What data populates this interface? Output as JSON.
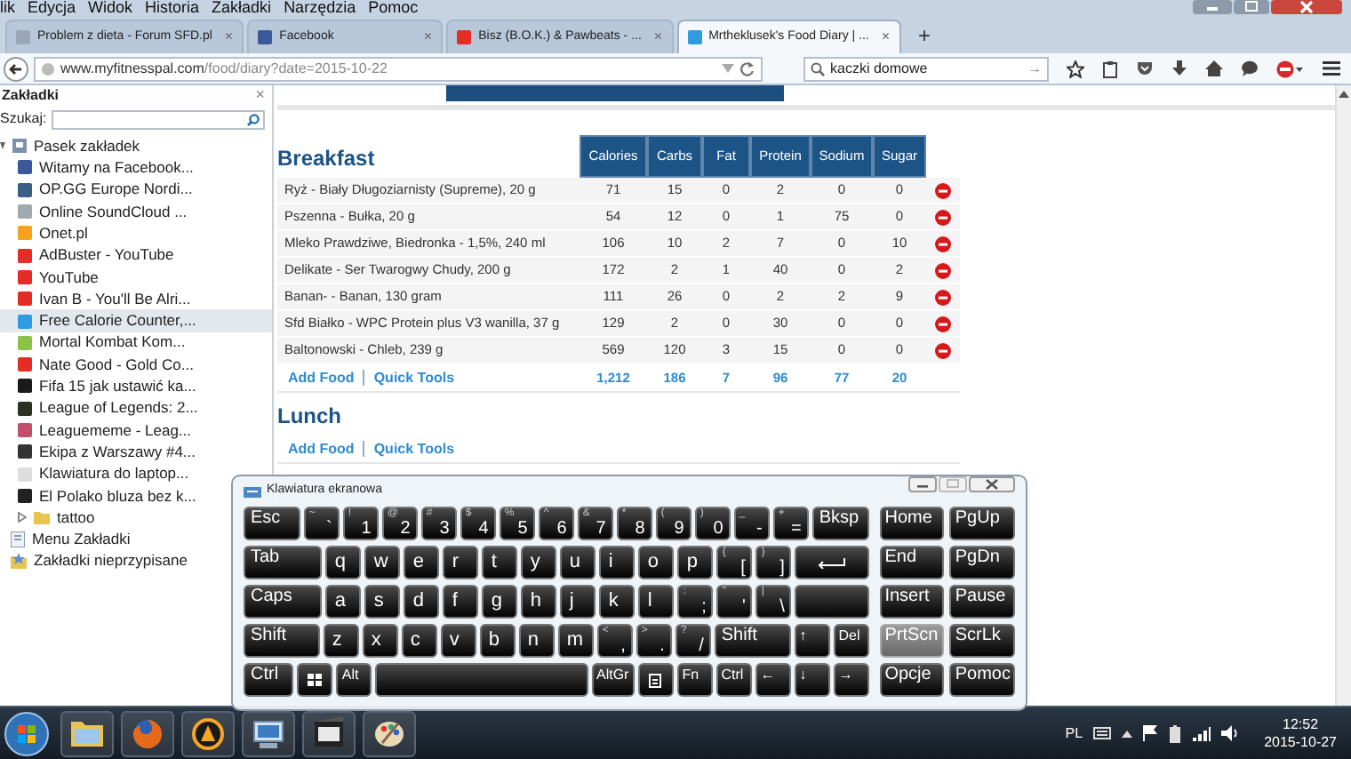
{
  "menu": [
    "lik",
    "Edycja",
    "Widok",
    "Historia",
    "Zakładki",
    "Narzędzia",
    "Pomoc"
  ],
  "tabs": [
    {
      "title": "Problem z dieta - Forum SFD.pl",
      "close": "×",
      "selected": false,
      "color": "#9aa7b8"
    },
    {
      "title": "Facebook",
      "close": "×",
      "selected": false,
      "color": "#3b5998"
    },
    {
      "title": "Bisz (B.O.K.) & Pawbeats - ...",
      "close": "×",
      "selected": false,
      "color": "#e52d27"
    },
    {
      "title": "Mrtheklusek's Food Diary | ...",
      "close": "×",
      "selected": true,
      "color": "#2f9be0"
    }
  ],
  "new_tab": "+",
  "address": {
    "host": "www.myfitnesspal.com",
    "path": "/food/diary?date=2015-10-22"
  },
  "search": {
    "value": "kaczki domowe",
    "go": "→"
  },
  "sidebar": {
    "title": "Zakładki",
    "close": "×",
    "search_label": "Szukaj:",
    "tree": [
      {
        "label": "Pasek zakładek",
        "kind": "toolbar",
        "selected": false,
        "expanded": true,
        "children": [
          {
            "label": "Witamy na Facebook...",
            "kind": "bookmark",
            "selected": false,
            "color": "#3b5998"
          },
          {
            "label": "OP.GG Europe Nordi...",
            "kind": "bookmark",
            "selected": false,
            "color": "#3a5f86"
          },
          {
            "label": "Online SoundCloud ...",
            "kind": "bookmark",
            "selected": false,
            "color": "#a0a8b0"
          },
          {
            "label": "Onet.pl",
            "kind": "bookmark",
            "selected": false,
            "color": "#f7a21b"
          },
          {
            "label": "AdBuster - YouTube",
            "kind": "bookmark",
            "selected": false,
            "color": "#e52d27"
          },
          {
            "label": "YouTube",
            "kind": "bookmark",
            "selected": false,
            "color": "#e52d27"
          },
          {
            "label": "Ivan B - You'll Be Alri...",
            "kind": "bookmark",
            "selected": false,
            "color": "#e52d27"
          },
          {
            "label": "Free Calorie Counter,...",
            "kind": "bookmark",
            "selected": true,
            "color": "#2f9be0"
          },
          {
            "label": "Mortal Kombat Kom...",
            "kind": "bookmark",
            "selected": false,
            "color": "#8bc34a"
          },
          {
            "label": "Nate Good - Gold Co...",
            "kind": "bookmark",
            "selected": false,
            "color": "#e52d27"
          },
          {
            "label": "Fifa 15 jak ustawić ka...",
            "kind": "bookmark",
            "selected": false,
            "color": "#1a1a1a"
          },
          {
            "label": "League of Legends: 2...",
            "kind": "bookmark",
            "selected": false,
            "color": "#2a3320"
          },
          {
            "label": "Leaguememe - Leag...",
            "kind": "bookmark",
            "selected": false,
            "color": "#c2506a"
          },
          {
            "label": "Ekipa z Warszawy #4...",
            "kind": "bookmark",
            "selected": false,
            "color": "#333333"
          },
          {
            "label": "Klawiatura do laptop...",
            "kind": "bookmark",
            "selected": false,
            "color": "#dddddd"
          },
          {
            "label": "El Polako bluza bez k...",
            "kind": "bookmark",
            "selected": false,
            "color": "#222222"
          },
          {
            "label": "tattoo",
            "kind": "folder",
            "selected": false,
            "expanded": false
          }
        ]
      },
      {
        "label": "Menu Zakładki",
        "kind": "menu",
        "selected": false
      },
      {
        "label": "Zakładki nieprzypisane",
        "kind": "unsorted",
        "selected": false
      }
    ]
  },
  "diary": [
    {
      "title": "Breakfast",
      "columns": [
        "Calories",
        "Carbs",
        "Fat",
        "Protein",
        "Sodium",
        "Sugar"
      ],
      "rows": [
        {
          "food": "Ryż - Biały Długoziarnisty (Supreme), 20 g",
          "values": [
            "71",
            "15",
            "0",
            "2",
            "0",
            "0"
          ]
        },
        {
          "food": "Pszenna - Bułka, 20 g",
          "values": [
            "54",
            "12",
            "0",
            "1",
            "75",
            "0"
          ]
        },
        {
          "food": "Mleko Prawdziwe, Biedronka - 1,5%, 240 ml",
          "values": [
            "106",
            "10",
            "2",
            "7",
            "0",
            "10"
          ]
        },
        {
          "food": "Delikate - Ser Twarogwy Chudy, 200 g",
          "values": [
            "172",
            "2",
            "1",
            "40",
            "0",
            "2"
          ]
        },
        {
          "food": "Banan- - Banan, 130 gram",
          "values": [
            "111",
            "26",
            "0",
            "2",
            "2",
            "9"
          ]
        },
        {
          "food": "Sfd Białko - WPC Protein plus V3 wanilla, 37 g",
          "values": [
            "129",
            "2",
            "0",
            "30",
            "0",
            "0"
          ]
        },
        {
          "food": "Baltonowski - Chleb, 239 g",
          "values": [
            "569",
            "120",
            "3",
            "15",
            "0",
            "0"
          ]
        }
      ],
      "totals": [
        "1,212",
        "186",
        "7",
        "96",
        "77",
        "20"
      ],
      "actions": [
        "Add Food",
        "Quick Tools"
      ]
    },
    {
      "title": "Lunch",
      "actions": [
        "Add Food",
        "Quick Tools"
      ]
    }
  ],
  "keyboard": {
    "title": "Klawiatura ekranowa",
    "rows": [
      {
        "keys": [
          {
            "kind": "label",
            "label": "Esc"
          },
          {
            "kind": "char",
            "shift": "~",
            "label": "`"
          },
          {
            "kind": "char",
            "shift": "!",
            "label": "1"
          },
          {
            "kind": "char",
            "shift": "@",
            "label": "2"
          },
          {
            "kind": "char",
            "shift": "#",
            "label": "3"
          },
          {
            "kind": "char",
            "shift": "$",
            "label": "4"
          },
          {
            "kind": "char",
            "shift": "%",
            "label": "5"
          },
          {
            "kind": "char",
            "shift": "^",
            "label": "6"
          },
          {
            "kind": "char",
            "shift": "&",
            "label": "7"
          },
          {
            "kind": "char",
            "shift": "*",
            "label": "8"
          },
          {
            "kind": "char",
            "shift": "(",
            "label": "9"
          },
          {
            "kind": "char",
            "shift": ")",
            "label": "0"
          },
          {
            "kind": "char",
            "shift": "_",
            "label": "-"
          },
          {
            "kind": "char",
            "shift": "+",
            "label": "="
          },
          {
            "kind": "label",
            "label": "Bksp"
          }
        ]
      },
      {
        "keys": [
          {
            "kind": "label",
            "label": "Tab"
          },
          {
            "kind": "letter",
            "label": "q"
          },
          {
            "kind": "letter",
            "label": "w"
          },
          {
            "kind": "letter",
            "label": "e"
          },
          {
            "kind": "letter",
            "label": "r"
          },
          {
            "kind": "letter",
            "label": "t"
          },
          {
            "kind": "letter",
            "label": "y"
          },
          {
            "kind": "letter",
            "label": "u"
          },
          {
            "kind": "letter",
            "label": "i"
          },
          {
            "kind": "letter",
            "label": "o"
          },
          {
            "kind": "letter",
            "label": "p"
          },
          {
            "kind": "char",
            "shift": "{",
            "label": "["
          },
          {
            "kind": "char",
            "shift": "}",
            "label": "]"
          },
          {
            "kind": "enter"
          }
        ]
      },
      {
        "keys": [
          {
            "kind": "label",
            "label": "Caps"
          },
          {
            "kind": "letter",
            "label": "a"
          },
          {
            "kind": "letter",
            "label": "s"
          },
          {
            "kind": "letter",
            "label": "d"
          },
          {
            "kind": "letter",
            "label": "f"
          },
          {
            "kind": "letter",
            "label": "g"
          },
          {
            "kind": "letter",
            "label": "h"
          },
          {
            "kind": "letter",
            "label": "j"
          },
          {
            "kind": "letter",
            "label": "k"
          },
          {
            "kind": "letter",
            "label": "l"
          },
          {
            "kind": "char",
            "shift": ":",
            "label": ";"
          },
          {
            "kind": "char",
            "shift": "\"",
            "label": "'"
          },
          {
            "kind": "char",
            "shift": "|",
            "label": "\\"
          },
          {
            "kind": "blank"
          }
        ]
      },
      {
        "keys": [
          {
            "kind": "label",
            "label": "Shift"
          },
          {
            "kind": "letter",
            "label": "z"
          },
          {
            "kind": "letter",
            "label": "x"
          },
          {
            "kind": "letter",
            "label": "c"
          },
          {
            "kind": "letter",
            "label": "v"
          },
          {
            "kind": "letter",
            "label": "b"
          },
          {
            "kind": "letter",
            "label": "n"
          },
          {
            "kind": "letter",
            "label": "m"
          },
          {
            "kind": "char",
            "shift": "<",
            "label": ","
          },
          {
            "kind": "char",
            "shift": ">",
            "label": "."
          },
          {
            "kind": "char",
            "shift": "?",
            "label": "/"
          },
          {
            "kind": "label",
            "label": "Shift"
          },
          {
            "kind": "small",
            "label": "↑"
          },
          {
            "kind": "small",
            "label": "Del"
          }
        ]
      },
      {
        "keys": [
          {
            "kind": "label",
            "label": "Ctrl"
          },
          {
            "kind": "windows"
          },
          {
            "kind": "small",
            "label": "Alt"
          },
          {
            "kind": "space"
          },
          {
            "kind": "small",
            "label": "AltGr"
          },
          {
            "kind": "menu-key"
          },
          {
            "kind": "small",
            "label": "Fn"
          },
          {
            "kind": "small",
            "label": "Ctrl"
          },
          {
            "kind": "small",
            "label": "←"
          },
          {
            "kind": "small",
            "label": "↓"
          },
          {
            "kind": "small",
            "label": "→"
          }
        ]
      }
    ],
    "nav": [
      {
        "label": "Home",
        "pressed": false
      },
      {
        "label": "PgUp",
        "pressed": false
      },
      {
        "label": "End",
        "pressed": false
      },
      {
        "label": "PgDn",
        "pressed": false
      },
      {
        "label": "Insert",
        "pressed": false
      },
      {
        "label": "Pause",
        "pressed": false
      },
      {
        "label": "PrtScn",
        "pressed": true
      },
      {
        "label": "ScrLk",
        "pressed": false
      },
      {
        "label": "Opcje",
        "pressed": false
      },
      {
        "label": "Pomoc",
        "pressed": false
      }
    ]
  },
  "taskbar": {
    "apps": [
      {
        "kind": "folder"
      },
      {
        "kind": "firefox"
      },
      {
        "kind": "player"
      },
      {
        "kind": "network"
      },
      {
        "kind": "video"
      },
      {
        "kind": "paint"
      }
    ],
    "language": "PL",
    "time": "12:52",
    "date": "2015-10-27"
  }
}
